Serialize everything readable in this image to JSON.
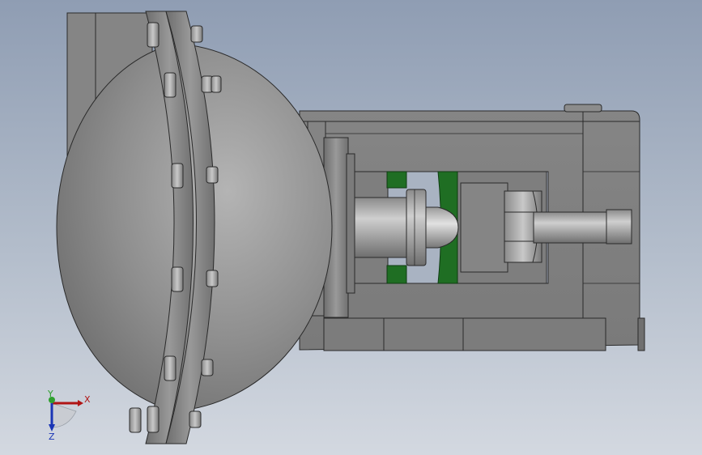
{
  "viewport": {
    "triad": {
      "x_label": "X",
      "y_label": "Y",
      "z_label": "Z",
      "x_color": "#b01515",
      "y_color": "#2fa02f",
      "z_color": "#1a35b5"
    },
    "colors": {
      "body_metal": "#7f7f7f",
      "dome_highlight": "#b0b0b0",
      "green_parts": "#1f6e23",
      "edge": "#2a2a2a"
    }
  }
}
